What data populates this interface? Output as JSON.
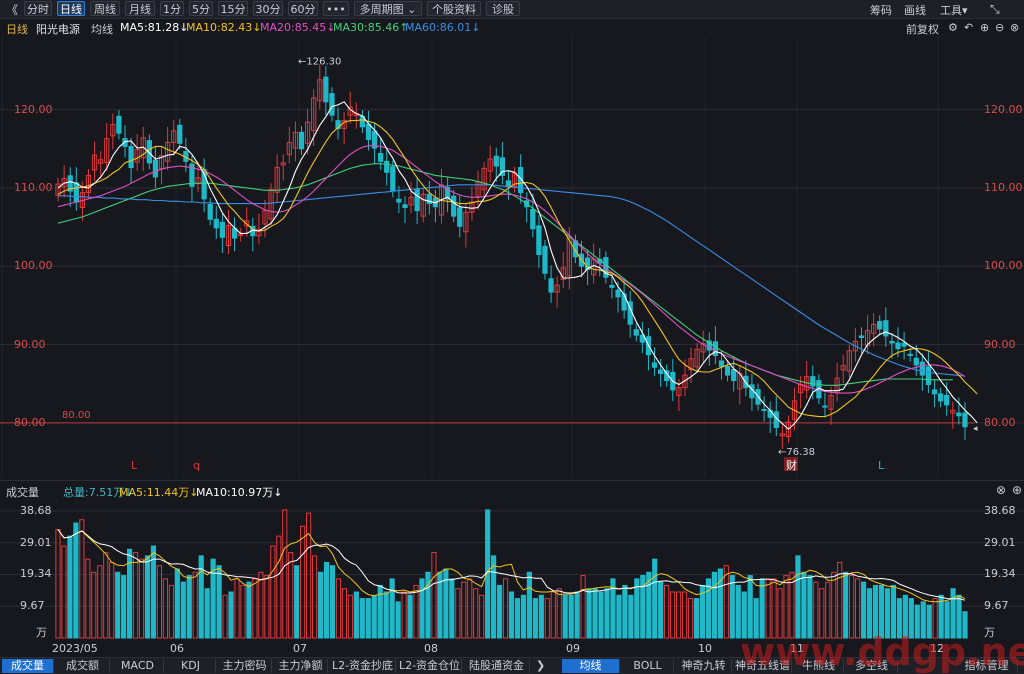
{
  "toolbar": {
    "back_glyph": "《",
    "tabs": [
      "分时",
      "日线",
      "周线",
      "月线",
      "1分",
      "5分",
      "15分",
      "30分",
      "60分",
      "•••",
      "多周期图 ⌄",
      "个股资料",
      "诊股"
    ],
    "active_tab": 1,
    "right": [
      "筹码",
      "画线",
      "工具▾"
    ],
    "expand_glyph": "⤡"
  },
  "legend": {
    "period": "日线",
    "stock_name": "阳光电源",
    "avg_label": "均线",
    "ma5": "MA5:81.28↓",
    "ma10": "MA10:82.43↓",
    "ma20": "MA20:85.45↓",
    "ma30": "MA30:85.46↑",
    "ma60": "MA60:86.01↓",
    "adjust": "前复权",
    "colors": {
      "ma5": "#ffffff",
      "ma10": "#f0c419",
      "ma20": "#e04fc7",
      "ma30": "#3fd07a",
      "ma60": "#3a8de8"
    }
  },
  "price_axis": {
    "labels": [
      "120.00",
      "110.00",
      "100.00",
      "90.00",
      "80.00"
    ],
    "values": [
      120,
      110,
      100,
      90,
      80
    ],
    "high_marker": "126.30",
    "low_marker": "76.38",
    "ref_line_label": "80.00"
  },
  "markers": [
    "L",
    "q",
    "财",
    "L"
  ],
  "volume_panel": {
    "title": "成交量",
    "total": "总量:7.51万↓",
    "ma5": "MA5:11.44万↓",
    "ma10": "MA10:10.97万↓",
    "axis_labels": [
      "38.68",
      "29.01",
      "19.34",
      "9.67"
    ],
    "axis_values": [
      38.68,
      29.01,
      19.34,
      9.67
    ],
    "unit": "万"
  },
  "months": [
    "2023/05",
    "06",
    "07",
    "08",
    "09",
    "10",
    "11",
    "12"
  ],
  "bottom_tabs": [
    "成交量",
    "成交额",
    "MACD",
    "KDJ",
    "主力密码",
    "主力净额",
    "L2-资金抄底",
    "L2-资金仓位",
    "陆股通资金",
    "均线",
    "BOLL",
    "神奇九转",
    "神奇五线谱",
    "牛熊线",
    "多空线",
    "指标管理"
  ],
  "watermark": "www.ddgp.net",
  "chart_data": {
    "type": "candlestick",
    "title": "阳光电源 日线",
    "ylim": [
      75,
      128
    ],
    "closes": [
      110.5,
      111.2,
      109.6,
      108.2,
      109.4,
      111.6,
      114.2,
      113.6,
      116.3,
      118.1,
      117.0,
      115.3,
      112.6,
      114.9,
      116.4,
      113.2,
      111.4,
      114.1,
      115.8,
      117.3,
      115.7,
      113.4,
      110.2,
      111.3,
      108.6,
      106.0,
      104.9,
      103.7,
      105.2,
      103.6,
      104.1,
      105.8,
      103.9,
      104.7,
      107.1,
      109.8,
      112.6,
      113.2,
      115.8,
      117.1,
      115.0,
      118.4,
      121.5,
      123.8,
      121.0,
      119.3,
      117.6,
      118.6,
      120.3,
      119.5,
      117.8,
      116.2,
      115.1,
      113.4,
      112.0,
      109.6,
      108.2,
      107.5,
      108.8,
      107.1,
      109.2,
      108.0,
      107.6,
      110.4,
      108.6,
      106.4,
      105.1,
      106.9,
      108.2,
      110.8,
      112.5,
      113.7,
      112.8,
      111.6,
      110.2,
      111.9,
      109.4,
      107.6,
      104.8,
      101.5,
      99.1,
      96.7,
      97.6,
      99.8,
      103.6,
      101.2,
      100.0,
      99.6,
      100.9,
      100.4,
      98.6,
      97.3,
      96.1,
      94.4,
      92.6,
      91.2,
      90.3,
      88.7,
      87.1,
      86.3,
      85.4,
      84.2,
      84.5,
      86.1,
      88.2,
      89.4,
      90.1,
      89.3,
      88.6,
      87.2,
      86.1,
      85.4,
      86.3,
      84.5,
      83.2,
      82.4,
      81.6,
      80.7,
      79.4,
      78.6,
      80.1,
      82.8,
      84.9,
      85.9,
      84.7,
      83.2,
      82.1,
      83.5,
      85.7,
      87.3,
      89.2,
      90.4,
      90.9,
      91.8,
      92.6,
      92.0,
      91.1,
      90.2,
      89.5,
      89.8,
      88.6,
      87.4,
      86.1,
      84.9,
      83.7,
      82.8,
      82.3,
      81.6,
      80.9,
      79.5
    ],
    "ma5": [
      110.0,
      110.6,
      110.8,
      110.6,
      110.1,
      110.0,
      110.6,
      111.4,
      112.5,
      114.1,
      115.2,
      115.9,
      116.0,
      115.1,
      115.2,
      114.5,
      113.7,
      113.9,
      114.2,
      114.3,
      115.3,
      115.1,
      114.3,
      113.1,
      111.8,
      109.9,
      108.4,
      106.8,
      105.7,
      104.9,
      104.2,
      104.2,
      104.6,
      104.5,
      105.0,
      105.5,
      106.6,
      108.3,
      110.0,
      112.1,
      113.7,
      114.9,
      116.5,
      118.0,
      119.1,
      120.4,
      120.6,
      121.0,
      120.0,
      119.5,
      119.2,
      118.2,
      117.4,
      116.4,
      115.0,
      113.8,
      112.2,
      111.1,
      109.6,
      109.0,
      108.5,
      108.3,
      108.1,
      108.5,
      108.8,
      108.1,
      107.6,
      107.5,
      107.4,
      107.5,
      108.7,
      110.0,
      111.2,
      112.1,
      112.2,
      112.0,
      111.2,
      110.2,
      108.8,
      107.0,
      104.9,
      102.0,
      99.8,
      98.5,
      98.5,
      98.6,
      98.8,
      99.7,
      100.1,
      99.8,
      99.1,
      98.8,
      97.4,
      96.4,
      94.6,
      92.9,
      91.5,
      89.9,
      88.6,
      87.4,
      86.3,
      85.3,
      84.9,
      85.4,
      85.9,
      86.5,
      87.6,
      88.6,
      89.1,
      88.9,
      87.9,
      86.9,
      86.3,
      85.1,
      84.3,
      83.4,
      82.4,
      81.6,
      80.6,
      79.9,
      79.2,
      79.9,
      80.9,
      82.3,
      83.9,
      84.4,
      84.1,
      84.1,
      84.1,
      84.3,
      85.5,
      87.1,
      88.7,
      90.0,
      90.7,
      91.3,
      91.6,
      91.3,
      90.9,
      90.4,
      89.8,
      89.4,
      88.6,
      87.6,
      86.6,
      85.4,
      84.4,
      83.3,
      82.5,
      81.6,
      80.9,
      80.0
    ],
    "ma10": [
      109.2,
      109.6,
      109.9,
      110.0,
      110.1,
      110.3,
      110.6,
      110.9,
      111.3,
      111.9,
      112.4,
      113.2,
      113.5,
      113.8,
      114.3,
      114.9,
      115.3,
      115.3,
      114.9,
      114.6,
      114.3,
      113.9,
      113.5,
      113.0,
      112.4,
      111.2,
      110.0,
      108.9,
      107.8,
      107.0,
      106.1,
      105.4,
      104.7,
      104.5,
      104.6,
      105.1,
      105.5,
      106.1,
      107.2,
      108.7,
      110.3,
      111.9,
      113.3,
      114.6,
      115.9,
      117.0,
      117.7,
      118.4,
      118.6,
      118.6,
      118.7,
      118.5,
      118.3,
      117.8,
      117.1,
      116.2,
      115.0,
      113.8,
      112.4,
      111.3,
      110.3,
      109.4,
      108.8,
      108.4,
      108.3,
      108.2,
      108.0,
      108.0,
      108.1,
      108.3,
      108.3,
      108.5,
      108.9,
      109.4,
      110.0,
      110.5,
      110.6,
      110.7,
      110.5,
      109.9,
      108.9,
      107.5,
      106.0,
      104.6,
      103.3,
      102.0,
      100.8,
      99.9,
      99.6,
      99.5,
      99.3,
      99.1,
      98.6,
      97.9,
      97.3,
      96.5,
      95.5,
      94.3,
      93.1,
      91.9,
      90.6,
      89.3,
      88.1,
      87.4,
      86.9,
      86.6,
      86.5,
      86.5,
      86.8,
      87.1,
      87.4,
      87.6,
      87.3,
      86.9,
      86.5,
      86.0,
      85.3,
      84.4,
      83.6,
      82.8,
      82.0,
      81.6,
      81.2,
      81.0,
      80.9,
      80.8,
      80.8,
      81.1,
      81.5,
      82.1,
      82.7,
      83.3,
      84.2,
      85.1,
      86.0,
      87.0,
      87.9,
      88.6,
      89.0,
      89.2,
      89.4,
      89.5,
      89.4,
      89.2,
      88.8,
      88.3,
      87.6,
      86.8,
      86.1,
      85.2,
      84.5,
      83.7
    ],
    "ma20": [
      107.6,
      107.8,
      108.0,
      108.2,
      108.4,
      108.6,
      108.8,
      109.0,
      109.3,
      109.6,
      109.9,
      110.2,
      110.6,
      111.0,
      111.4,
      111.8,
      112.1,
      112.4,
      112.6,
      112.7,
      112.8,
      112.7,
      112.6,
      112.4,
      112.2,
      111.8,
      111.4,
      110.9,
      110.3,
      109.7,
      109.1,
      108.5,
      108.0,
      107.6,
      107.2,
      107.0,
      106.9,
      107.0,
      107.3,
      107.8,
      108.3,
      108.9,
      109.6,
      110.4,
      111.2,
      112.0,
      112.8,
      113.6,
      114.3,
      114.8,
      115.2,
      115.4,
      115.4,
      115.3,
      115.1,
      114.8,
      114.3,
      113.8,
      113.2,
      112.6,
      112.0,
      111.4,
      110.8,
      110.3,
      109.8,
      109.4,
      109.1,
      108.9,
      108.8,
      108.8,
      108.9,
      109.0,
      109.1,
      109.2,
      109.2,
      109.1,
      108.9,
      108.6,
      108.2,
      107.7,
      107.1,
      106.4,
      105.6,
      104.8,
      104.0,
      103.2,
      102.4,
      101.6,
      100.9,
      100.3,
      99.7,
      99.2,
      98.7,
      98.2,
      97.7,
      97.1,
      96.5,
      95.8,
      95.1,
      94.4,
      93.7,
      93.0,
      92.3,
      91.7,
      91.1,
      90.5,
      90.0,
      89.6,
      89.2,
      88.8,
      88.5,
      88.2,
      87.9,
      87.6,
      87.3,
      87.0,
      86.7,
      86.4,
      86.1,
      85.8,
      85.5,
      85.2,
      84.9,
      84.6,
      84.4,
      84.2,
      84.0,
      83.9,
      83.8,
      83.8,
      83.8,
      83.9,
      84.1,
      84.4,
      84.7,
      85.1,
      85.5,
      85.9,
      86.3,
      86.6,
      86.9,
      87.1,
      87.3,
      87.4,
      87.4,
      87.3,
      87.1,
      86.8,
      86.4,
      85.9
    ],
    "ma30": [
      105.5,
      105.7,
      105.9,
      106.1,
      106.3,
      106.6,
      106.9,
      107.2,
      107.5,
      107.8,
      108.1,
      108.4,
      108.7,
      109.0,
      109.3,
      109.6,
      109.8,
      110.0,
      110.2,
      110.3,
      110.4,
      110.5,
      110.6,
      110.6,
      110.6,
      110.6,
      110.5,
      110.4,
      110.3,
      110.2,
      110.1,
      110.0,
      109.9,
      109.8,
      109.7,
      109.7,
      109.7,
      109.8,
      109.9,
      110.0,
      110.2,
      110.4,
      110.7,
      111.0,
      111.3,
      111.6,
      111.9,
      112.2,
      112.5,
      112.7,
      112.9,
      113.0,
      113.1,
      113.1,
      113.0,
      112.9,
      112.8,
      112.6,
      112.4,
      112.2,
      112.0,
      111.8,
      111.6,
      111.5,
      111.4,
      111.3,
      111.2,
      111.1,
      111.0,
      110.8,
      110.6,
      110.4,
      110.1,
      109.8,
      109.4,
      109.0,
      108.5,
      108.0,
      107.4,
      106.8,
      106.2,
      105.6,
      105.0,
      104.4,
      103.8,
      103.2,
      102.6,
      102.0,
      101.4,
      100.8,
      100.2,
      99.6,
      99.0,
      98.4,
      97.8,
      97.2,
      96.6,
      96.0,
      95.4,
      94.8,
      94.2,
      93.6,
      93.0,
      92.4,
      91.8,
      91.2,
      90.7,
      90.2,
      89.7,
      89.2,
      88.8,
      88.4,
      88.0,
      87.6,
      87.3,
      87.0,
      86.7,
      86.4,
      86.1,
      85.9,
      85.7,
      85.5,
      85.3,
      85.1,
      85.0,
      84.9,
      84.8,
      84.8,
      84.8,
      84.9,
      85.0,
      85.1,
      85.2,
      85.3,
      85.4,
      85.5,
      85.6,
      85.6,
      85.6,
      85.6,
      85.6,
      85.6,
      85.6,
      85.5,
      85.5,
      85.5,
      85.5,
      85.5
    ],
    "ma60": [
      109.0,
      109.0,
      108.9,
      108.9,
      108.8,
      108.8,
      108.7,
      108.7,
      108.6,
      108.6,
      108.5,
      108.5,
      108.4,
      108.4,
      108.3,
      108.3,
      108.2,
      108.2,
      108.1,
      108.1,
      108.0,
      108.0,
      108.0,
      108.0,
      108.0,
      108.0,
      108.0,
      108.1,
      108.2,
      108.3,
      108.4,
      108.5,
      108.6,
      108.7,
      108.8,
      108.9,
      109.0,
      109.1,
      109.2,
      109.3,
      109.4,
      109.5,
      109.6,
      109.7,
      109.8,
      109.9,
      110.0,
      110.1,
      110.2,
      110.3,
      110.4,
      110.4,
      110.4,
      110.4,
      110.4,
      110.3,
      110.2,
      110.1,
      110.0,
      109.9,
      109.8,
      109.7,
      109.6,
      109.5,
      109.4,
      109.3,
      109.2,
      109.1,
      109.0,
      108.9,
      108.7,
      108.4,
      108.0,
      107.5,
      107.0,
      106.4,
      105.8,
      105.1,
      104.4,
      103.7,
      103.0,
      102.3,
      101.6,
      100.9,
      100.2,
      99.5,
      98.8,
      98.1,
      97.4,
      96.7,
      96.0,
      95.3,
      94.6,
      93.9,
      93.2,
      92.5,
      91.9,
      91.3,
      90.7,
      90.1,
      89.6,
      89.1,
      88.6,
      88.2,
      87.8,
      87.4,
      87.1,
      86.8,
      86.6,
      86.4,
      86.3,
      86.2,
      86.1,
      86.0
    ],
    "volumes": [
      33,
      28,
      31,
      35,
      36,
      24,
      20,
      22,
      26,
      23,
      20,
      19,
      27,
      26,
      24,
      25,
      28,
      22,
      18,
      16,
      21,
      17,
      19,
      20,
      25,
      15,
      24,
      22,
      13,
      14,
      18,
      16,
      17,
      18,
      20,
      19,
      28,
      31,
      39,
      26,
      22,
      34,
      38,
      25,
      20,
      23,
      22,
      18,
      15,
      13,
      14,
      12,
      12,
      13,
      16,
      14,
      18,
      11,
      14,
      13,
      16,
      18,
      20,
      26,
      20,
      21,
      18,
      15,
      17,
      18,
      15,
      13,
      39,
      25,
      16,
      18,
      14,
      12,
      13,
      20,
      12,
      13,
      12,
      14,
      15,
      13,
      13,
      14,
      19,
      15,
      15,
      14,
      15,
      18,
      13,
      16,
      13,
      18,
      19,
      20,
      24,
      17,
      16,
      14,
      14,
      14,
      12,
      12,
      16,
      18,
      20,
      21,
      22,
      19,
      16,
      14,
      19,
      12,
      18,
      18,
      18,
      15,
      19,
      20,
      25,
      20,
      19,
      17,
      15,
      17,
      20,
      23,
      20,
      19,
      18,
      17,
      15,
      16,
      16,
      15,
      16,
      12,
      13,
      12,
      10,
      11,
      10,
      12,
      13,
      11,
      15,
      13,
      8
    ]
  }
}
